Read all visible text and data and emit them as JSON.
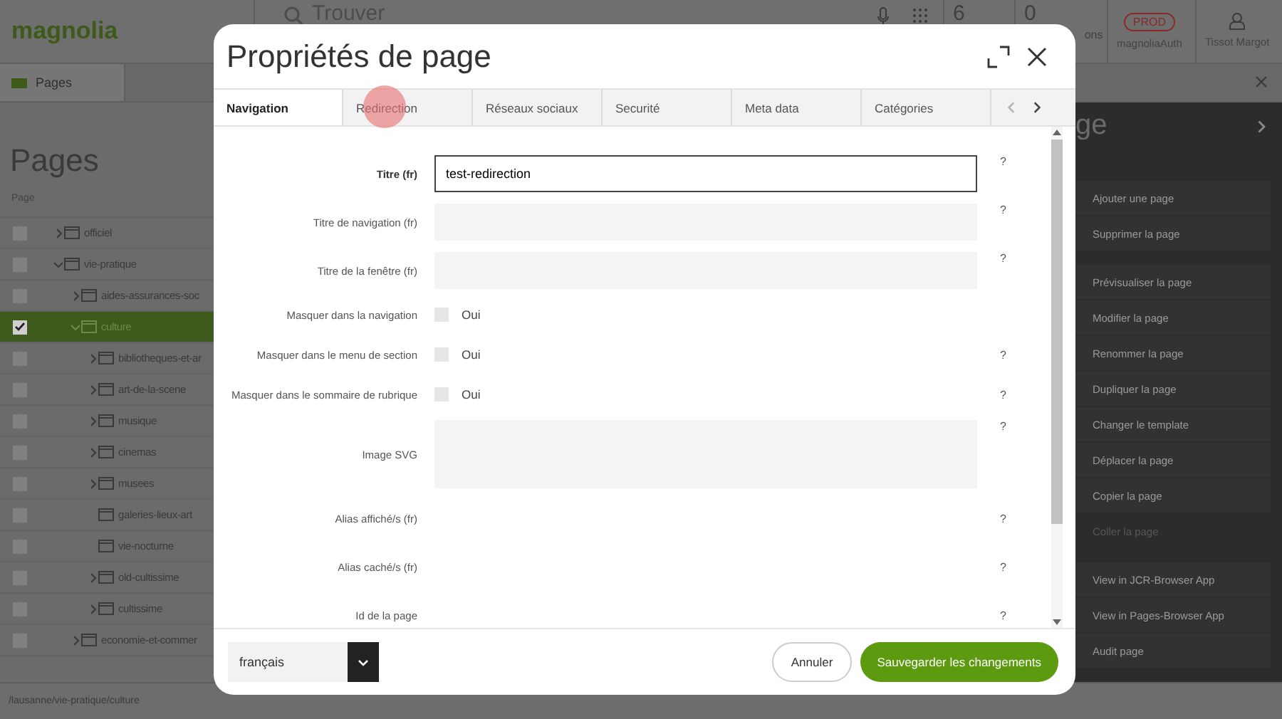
{
  "app": {
    "logo": "magnolia",
    "search": {
      "placeholder": "Trouver"
    },
    "topbar": {
      "tasks": "6",
      "notifications": "0",
      "notifications_label": "ons",
      "environment": "PROD",
      "instance": "magnoliaAuth",
      "user": "Tissot Margot"
    }
  },
  "app_tabs": [
    {
      "label": "Pages",
      "selected": true
    }
  ],
  "pages_panel": {
    "title": "Pages",
    "column": "Page",
    "tree": [
      {
        "label": "officiel",
        "has_children": true,
        "expanded": false,
        "checked": false,
        "selected": false
      },
      {
        "label": "vie-pratique",
        "has_children": true,
        "expanded": true,
        "checked": false,
        "selected": false,
        "children": [
          {
            "label": "aides-assurances-soc",
            "has_children": true,
            "expanded": false,
            "checked": false,
            "selected": false
          },
          {
            "label": "culture",
            "has_children": true,
            "expanded": true,
            "checked": true,
            "selected": true,
            "children": [
              {
                "label": "bibliotheques-et-ar",
                "has_children": true,
                "expanded": false,
                "checked": false,
                "selected": false
              },
              {
                "label": "art-de-la-scene",
                "has_children": true,
                "expanded": false,
                "checked": false,
                "selected": false
              },
              {
                "label": "musique",
                "has_children": true,
                "expanded": false,
                "checked": false,
                "selected": false
              },
              {
                "label": "cinemas",
                "has_children": true,
                "expanded": false,
                "checked": false,
                "selected": false
              },
              {
                "label": "musees",
                "has_children": true,
                "expanded": false,
                "checked": false,
                "selected": false
              },
              {
                "label": "galeries-lieux-art",
                "has_children": false,
                "checked": false,
                "selected": false
              },
              {
                "label": "vie-nocturne",
                "has_children": false,
                "checked": false,
                "selected": false
              },
              {
                "label": "old-cultissime",
                "has_children": true,
                "expanded": false,
                "checked": false,
                "selected": false
              },
              {
                "label": "cultissime",
                "has_children": true,
                "expanded": false,
                "checked": false,
                "selected": false
              }
            ]
          },
          {
            "label": "economie-et-commer",
            "has_children": true,
            "expanded": false,
            "checked": false,
            "selected": false
          }
        ]
      }
    ]
  },
  "actions_panel": {
    "title": "ge",
    "groups": [
      [
        {
          "label": "Ajouter une page",
          "disabled": false
        },
        {
          "label": "Supprimer la page",
          "disabled": false
        }
      ],
      [
        {
          "label": "Prévisualiser la page",
          "disabled": false
        },
        {
          "label": "Modifier la page",
          "disabled": false
        },
        {
          "label": "Renommer la page",
          "disabled": false
        },
        {
          "label": "Dupliquer la page",
          "disabled": false
        },
        {
          "label": "Changer le template",
          "disabled": false
        },
        {
          "label": "Déplacer la page",
          "disabled": false
        },
        {
          "label": "Copier la page",
          "disabled": false
        },
        {
          "label": "Coller la page",
          "disabled": true
        }
      ],
      [
        {
          "label": "View in JCR-Browser App",
          "disabled": false
        },
        {
          "label": "View in Pages-Browser App",
          "disabled": false
        },
        {
          "label": "Audit page",
          "disabled": false
        }
      ]
    ]
  },
  "status_bar": {
    "path": "/lausanne/vie-pratique/culture"
  },
  "dialog": {
    "title": "Propriétés de page",
    "tabs": [
      {
        "label": "Navigation",
        "selected": true
      },
      {
        "label": "Redirection",
        "selected": false
      },
      {
        "label": "Réseaux sociaux",
        "selected": false
      },
      {
        "label": "Securité",
        "selected": false
      },
      {
        "label": "Meta data",
        "selected": false
      },
      {
        "label": "Catégories",
        "selected": false
      }
    ],
    "fields": [
      {
        "kind": "text",
        "label": "Titre (fr)",
        "value": "test-redirection",
        "focused": true,
        "help": "?"
      },
      {
        "kind": "text",
        "label": "Titre de navigation (fr)",
        "focused": false,
        "help": "?"
      },
      {
        "kind": "text",
        "label": "Titre de la fenêtre (fr)",
        "focused": false,
        "help": "?"
      },
      {
        "kind": "checkbox",
        "label": "Masquer dans la navigation",
        "option": "Oui",
        "checked": false
      },
      {
        "kind": "checkbox",
        "label": "Masquer dans le menu de section",
        "option": "Oui",
        "checked": false,
        "help": "?"
      },
      {
        "kind": "checkbox",
        "label": "Masquer dans le sommaire de rubrique",
        "option": "Oui",
        "checked": false,
        "help": "?"
      },
      {
        "kind": "textarea",
        "label": "Image SVG",
        "help": "?"
      },
      {
        "kind": "plain",
        "label": "Alias affiché/s (fr)",
        "help": "?"
      },
      {
        "kind": "plain",
        "label": "Alias caché/s (fr)",
        "help": "?"
      },
      {
        "kind": "plain",
        "label": "Id de la page",
        "help": "?"
      }
    ],
    "language": "français",
    "buttons": [
      {
        "label": "Annuler",
        "kind": "secondary"
      },
      {
        "label": "Sauvegarder les changements",
        "kind": "primary"
      }
    ]
  }
}
